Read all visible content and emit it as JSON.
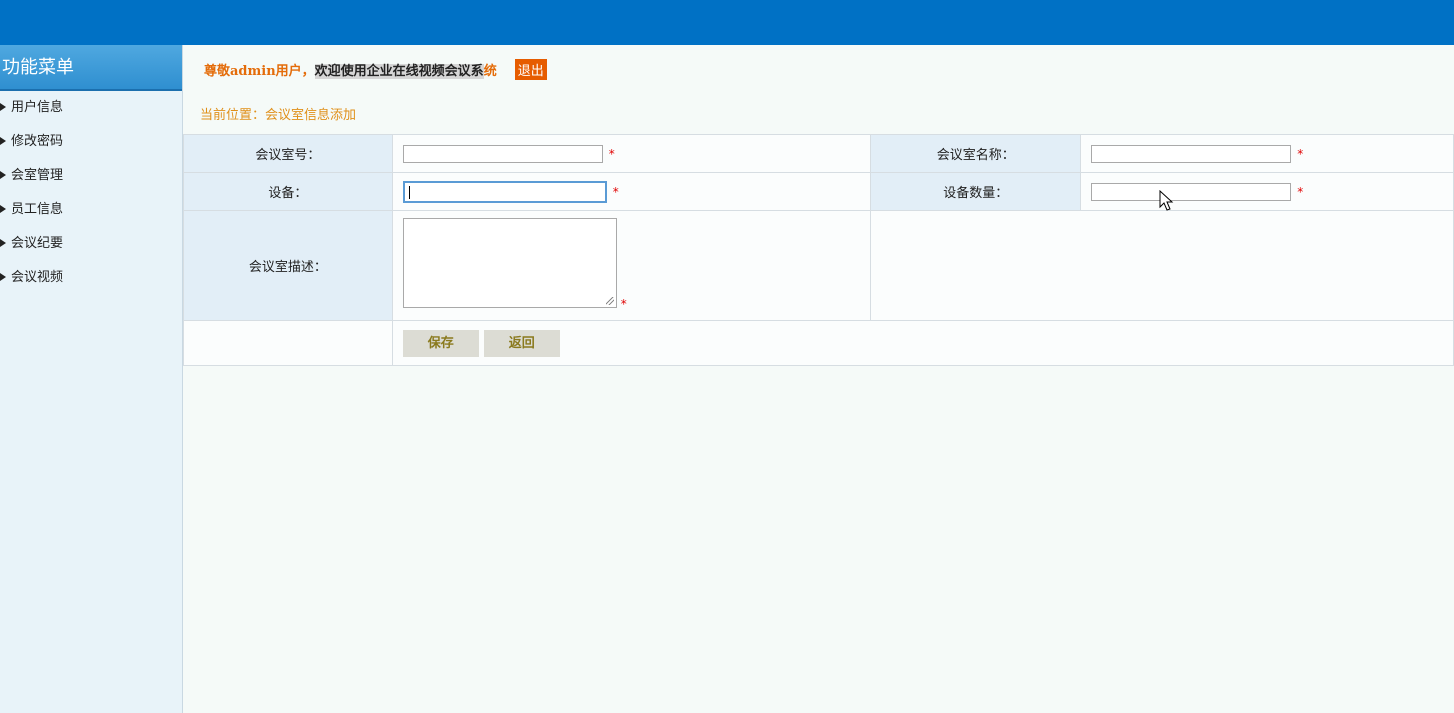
{
  "sidebar": {
    "title": "功能菜单",
    "items": [
      {
        "label": "用户信息"
      },
      {
        "label": "修改密码"
      },
      {
        "label": "会室管理"
      },
      {
        "label": "员工信息"
      },
      {
        "label": "会议纪要"
      },
      {
        "label": "会议视频"
      }
    ]
  },
  "header": {
    "welcome_prefix": "尊敬admin用户，",
    "welcome_middle": "欢迎使用企业在线视频会议系",
    "welcome_suffix": "统",
    "logout_label": "退出"
  },
  "breadcrumb": "当前位置：会议室信息添加",
  "form": {
    "room_no_label": "会议室号：",
    "room_name_label": "会议室名称：",
    "device_label": "设备：",
    "device_count_label": "设备数量：",
    "description_label": "会议室描述：",
    "required_mark": "*",
    "room_no_value": "",
    "room_name_value": "",
    "device_value": "",
    "device_count_value": "",
    "description_value": ""
  },
  "actions": {
    "save_label": "保存",
    "back_label": "返回"
  },
  "colors": {
    "topbar": "#0071c5",
    "accent_orange": "#e46c0a",
    "required_red": "#e00000"
  }
}
